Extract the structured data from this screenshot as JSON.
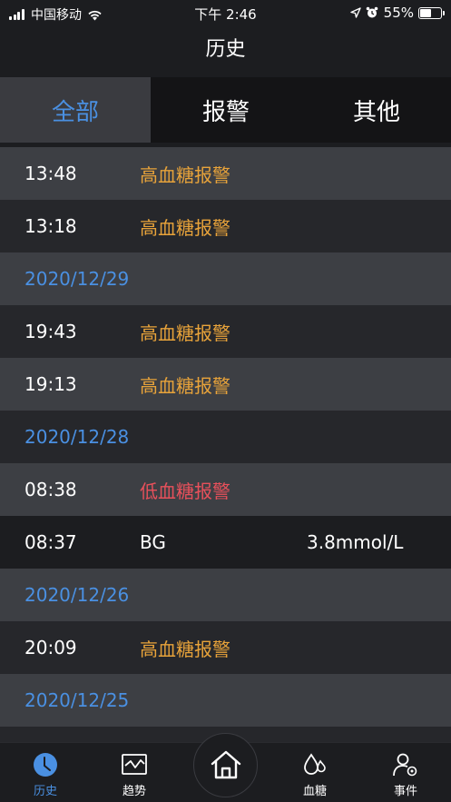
{
  "status_bar": {
    "carrier": "中国移动",
    "time": "下午 2:46",
    "battery": "55%",
    "battery_level": 0.55
  },
  "header": {
    "title": "历史"
  },
  "tabs": [
    {
      "label": "全部",
      "active": true
    },
    {
      "label": "报警",
      "active": false
    },
    {
      "label": "其他",
      "active": false
    }
  ],
  "history": {
    "rows": [
      {
        "type": "entry",
        "time": "13:48",
        "event": "高血糖报警",
        "event_color": "#e8a33a",
        "shade": "light"
      },
      {
        "type": "entry",
        "time": "13:18",
        "event": "高血糖报警",
        "event_color": "#e8a33a",
        "shade": "dark"
      },
      {
        "type": "date",
        "date": "2020/12/29",
        "shade": "light"
      },
      {
        "type": "entry",
        "time": "19:43",
        "event": "高血糖报警",
        "event_color": "#e8a33a",
        "shade": "dark"
      },
      {
        "type": "entry",
        "time": "19:13",
        "event": "高血糖报警",
        "event_color": "#e8a33a",
        "shade": "light"
      },
      {
        "type": "date",
        "date": "2020/12/28",
        "shade": "dark"
      },
      {
        "type": "entry",
        "time": "08:38",
        "event": "低血糖报警",
        "event_color": "#e8505b",
        "shade": "light"
      },
      {
        "type": "entry",
        "time": "08:37",
        "event": "BG",
        "event_color": "#ffffff",
        "value": "3.8mmol/L",
        "shade": "darker"
      },
      {
        "type": "date",
        "date": "2020/12/26",
        "shade": "light"
      },
      {
        "type": "entry",
        "time": "20:09",
        "event": "高血糖报警",
        "event_color": "#e8a33a",
        "shade": "dark"
      },
      {
        "type": "date",
        "date": "2020/12/25",
        "shade": "light"
      },
      {
        "type": "blank",
        "shade": "dark"
      }
    ]
  },
  "tabbar": {
    "items": [
      {
        "label": "历史",
        "icon": "clock-icon",
        "active": true
      },
      {
        "label": "趋势",
        "icon": "trend-chart-icon",
        "active": false
      },
      {
        "label": "",
        "icon": "home-icon",
        "active": false
      },
      {
        "label": "血糖",
        "icon": "blood-drop-icon",
        "active": false
      },
      {
        "label": "事件",
        "icon": "user-settings-icon",
        "active": false
      }
    ]
  },
  "colors": {
    "accent": "#4a90e2",
    "high_alert": "#e8a33a",
    "low_alert": "#e8505b"
  }
}
